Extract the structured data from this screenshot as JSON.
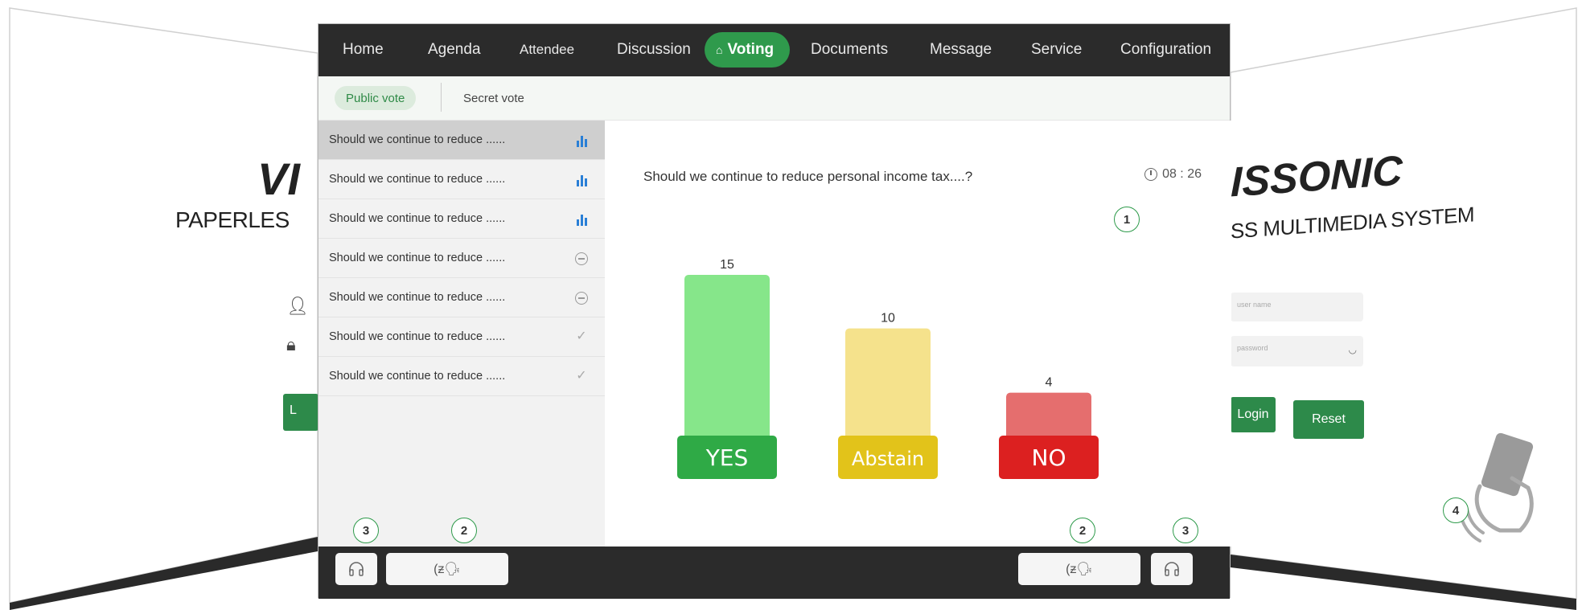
{
  "background": {
    "left_logo": "VI",
    "left_subtitle": "PAPERLES",
    "left_login_button": "L",
    "right_logo": "ISSONIC",
    "right_subtitle": "SS MULTIMEDIA SYSTEM",
    "right_username_placeholder": "user name",
    "right_password_placeholder": "password",
    "right_login_button": "Login",
    "right_reset_button": "Reset"
  },
  "nav": {
    "items": [
      {
        "label": "Home",
        "active": false
      },
      {
        "label": "Agenda",
        "active": false
      },
      {
        "label": "Attendee",
        "active": false
      },
      {
        "label": "Discussion",
        "active": false
      },
      {
        "label": "Voting",
        "active": true
      },
      {
        "label": "Documents",
        "active": false
      },
      {
        "label": "Message",
        "active": false
      },
      {
        "label": "Service",
        "active": false
      },
      {
        "label": "Configuration",
        "active": false
      }
    ]
  },
  "tabs": {
    "public": "Public vote",
    "secret": "Secret vote"
  },
  "topics": [
    {
      "label": "Should we continue to reduce ......",
      "status": "results",
      "selected": true
    },
    {
      "label": "Should we continue to reduce ......",
      "status": "results",
      "selected": false
    },
    {
      "label": "Should we continue to reduce ......",
      "status": "results",
      "selected": false
    },
    {
      "label": "Should we continue to reduce ......",
      "status": "pending",
      "selected": false
    },
    {
      "label": "Should we continue to reduce ......",
      "status": "pending",
      "selected": false
    },
    {
      "label": "Should we continue to reduce ......",
      "status": "done",
      "selected": false
    },
    {
      "label": "Should we continue to reduce ......",
      "status": "done",
      "selected": false
    }
  ],
  "question": "Should we continue to reduce personal income tax....?",
  "timer": "08 : 26",
  "colors": {
    "accent": "#2f9a4c",
    "yes_bar": "#86e68a",
    "yes_label": "#2faa46",
    "abstain_bar": "#f5e28c",
    "abstain_label": "#e2c31a",
    "no_bar": "#e56e6e",
    "no_label": "#dc2020"
  },
  "chart_data": {
    "type": "bar",
    "categories": [
      "YES",
      "Abstain",
      "NO"
    ],
    "values": [
      15,
      10,
      4
    ],
    "title": "",
    "xlabel": "",
    "ylabel": "",
    "ylim": [
      0,
      15
    ]
  },
  "badges": {
    "one": "1",
    "two": "2",
    "three": "3",
    "four": "4"
  }
}
